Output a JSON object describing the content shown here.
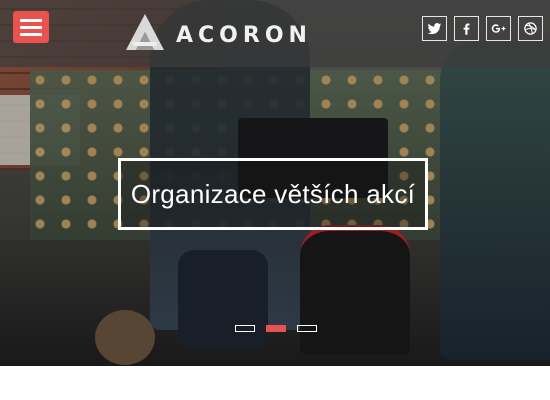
{
  "header": {
    "menu_icon": "hamburger-icon",
    "logo_text": "ACORON",
    "accent_color": "#e8524f"
  },
  "social": [
    {
      "name": "twitter",
      "icon": "twitter-icon"
    },
    {
      "name": "facebook",
      "icon": "facebook-icon",
      "glyph": "f"
    },
    {
      "name": "google-plus",
      "icon": "google-plus-icon",
      "glyph": "g+"
    },
    {
      "name": "dribbble",
      "icon": "dribbble-icon"
    }
  ],
  "slider": {
    "caption": "Organizace větších akcí",
    "slide_count": 3,
    "active_index": 1
  }
}
